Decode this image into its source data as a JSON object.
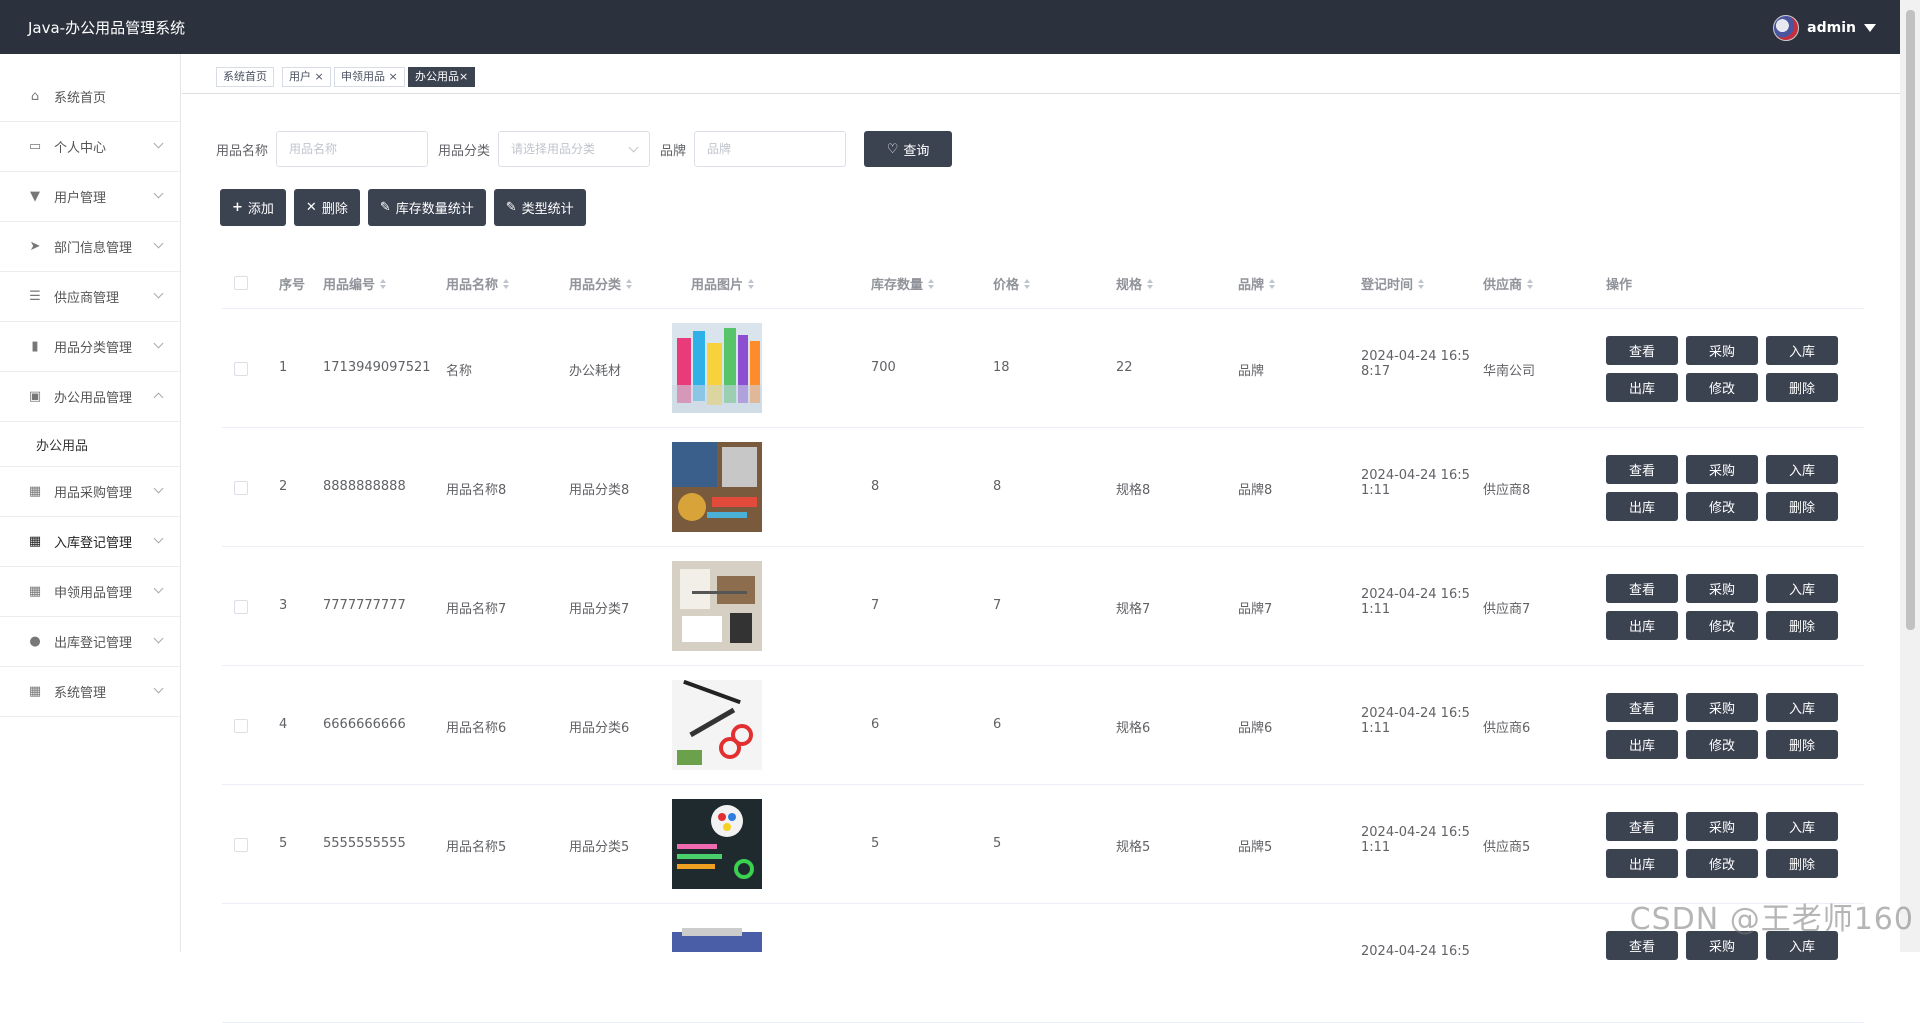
{
  "app": {
    "title": "Java-办公用品管理系统",
    "user": "admin"
  },
  "sidebar": {
    "items": [
      {
        "label": "系统首页",
        "icon": "home-icon"
      },
      {
        "label": "个人中心",
        "icon": "calendar-icon"
      },
      {
        "label": "用户管理",
        "icon": "user-icon"
      },
      {
        "label": "部门信息管理",
        "icon": "send-icon"
      },
      {
        "label": "供应商管理",
        "icon": "sliders-icon"
      },
      {
        "label": "用品分类管理",
        "icon": "bar-chart-icon"
      },
      {
        "label": "办公用品管理",
        "icon": "clipboard-icon"
      },
      {
        "label": "用品采购管理",
        "icon": "grid-icon"
      },
      {
        "label": "入库登记管理",
        "icon": "grid-icon"
      },
      {
        "label": "申领用品管理",
        "icon": "grid-icon"
      },
      {
        "label": "出库登记管理",
        "icon": "bulb-icon"
      },
      {
        "label": "系统管理",
        "icon": "grid-icon"
      }
    ],
    "submenu": {
      "label": "办公用品"
    }
  },
  "tabs": [
    "系统首页",
    "用户",
    "申领用品",
    "办公用品"
  ],
  "search": {
    "name_label": "用品名称",
    "name_placeholder": "用品名称",
    "category_label": "用品分类",
    "category_placeholder": "请选择用品分类",
    "brand_label": "品牌",
    "brand_placeholder": "品牌",
    "query_button": "查询"
  },
  "actions": {
    "add": "添加",
    "delete": "删除",
    "stock_stats": "库存数量统计",
    "type_stats": "类型统计"
  },
  "table": {
    "headers": [
      "序号",
      "用品编号",
      "用品名称",
      "用品分类",
      "用品图片",
      "库存数量",
      "价格",
      "规格",
      "品牌",
      "登记时间",
      "供应商",
      "操作"
    ],
    "rows": [
      {
        "no": "1",
        "code": "1713949097521",
        "name": "名称",
        "category": "办公耗材",
        "stock": "700",
        "price": "18",
        "spec": "22",
        "brand": "品牌",
        "time1": "2024-04-24 16:5",
        "time2": "8:17",
        "supplier": "华南公司"
      },
      {
        "no": "2",
        "code": "8888888888",
        "name": "用品名称8",
        "category": "用品分类8",
        "stock": "8",
        "price": "8",
        "spec": "规格8",
        "brand": "品牌8",
        "time1": "2024-04-24 16:5",
        "time2": "1:11",
        "supplier": "供应商8"
      },
      {
        "no": "3",
        "code": "7777777777",
        "name": "用品名称7",
        "category": "用品分类7",
        "stock": "7",
        "price": "7",
        "spec": "规格7",
        "brand": "品牌7",
        "time1": "2024-04-24 16:5",
        "time2": "1:11",
        "supplier": "供应商7"
      },
      {
        "no": "4",
        "code": "6666666666",
        "name": "用品名称6",
        "category": "用品分类6",
        "stock": "6",
        "price": "6",
        "spec": "规格6",
        "brand": "品牌6",
        "time1": "2024-04-24 16:5",
        "time2": "1:11",
        "supplier": "供应商6"
      },
      {
        "no": "5",
        "code": "5555555555",
        "name": "用品名称5",
        "category": "用品分类5",
        "stock": "5",
        "price": "5",
        "spec": "规格5",
        "brand": "品牌5",
        "time1": "2024-04-24 16:5",
        "time2": "1:11",
        "supplier": "供应商5"
      }
    ],
    "partial_row": {
      "time1": "2024-04-24 16:5"
    },
    "row_ops": [
      "查看",
      "采购",
      "入库",
      "出库",
      "修改",
      "删除"
    ]
  },
  "watermark": "CSDN @王老师160"
}
